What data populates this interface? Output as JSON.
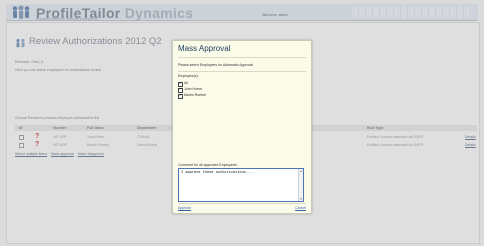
{
  "header": {
    "brand_primary": "ProfileTailor",
    "brand_secondary": " Dynamics",
    "tagline": "Business Behavior Security Intelligence",
    "user_link": "Welcome, admin"
  },
  "page": {
    "title": "Review Authorizations 2012 Q2",
    "reviewer_line": "Reviewer: Field_A",
    "instructions": "Here you can check employees for authorization review",
    "instructions2": "Choose Review to process employee authorization list",
    "actions": [
      "Select multiple items",
      "Mass approval",
      "Mass disapprove"
    ]
  },
  "table": {
    "columns": [
      "ID",
      "Number",
      "Full Name",
      "Department",
      "Role Type",
      ""
    ],
    "rows": [
      {
        "id": "",
        "number": "INT 4/9P",
        "full_name": "John Hobe",
        "department": "IT/Audit",
        "role_type": "Entitled, Access assessed via SAP®",
        "action": "Details"
      },
      {
        "id": "",
        "number": "INT 4/9P",
        "full_name": "Martin Roebel",
        "department": "Sales/Global",
        "role_type": "Entitled, Access assessed via SAP®",
        "action": "Details"
      }
    ]
  },
  "modal": {
    "title": "Mass Approval",
    "instruction": "Please select Employees for Automatic Approval",
    "employees_label": "Employee(s):",
    "employees": [
      {
        "label": "All",
        "checked": true
      },
      {
        "label": "John Hoem",
        "checked": true
      },
      {
        "label": "Martin Roebel",
        "checked": true
      }
    ],
    "comment_label": "Comment for all approved Employees:",
    "comment_value": "I approve these authorizations...",
    "approve_link": "Approve",
    "cancel_link": "Cancel"
  },
  "colors": {
    "modal_bg": "#fbfbea",
    "title": "#1c3b5b",
    "link": "#3b63a8",
    "textarea_border": "#4c74b8"
  }
}
